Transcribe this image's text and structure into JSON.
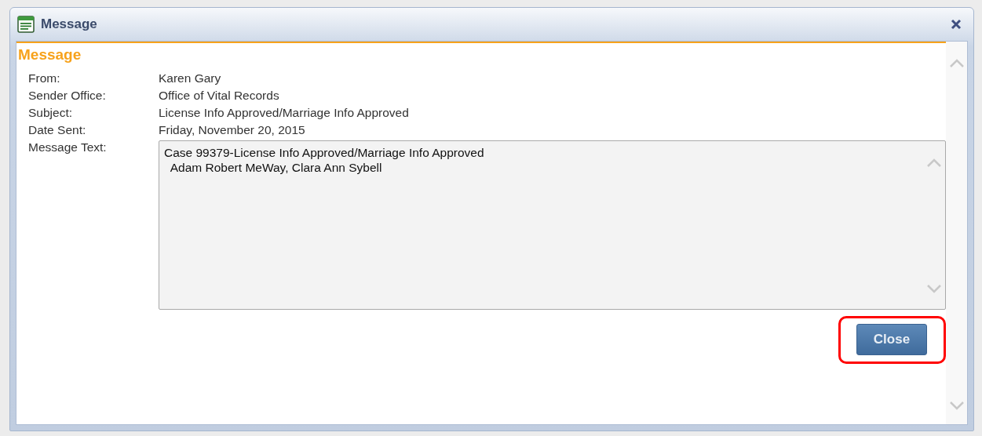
{
  "window": {
    "title": "Message"
  },
  "section_title": "Message",
  "fields": [
    {
      "label": "From:",
      "value": "Karen Gary"
    },
    {
      "label": "Sender Office:",
      "value": "Office of Vital Records"
    },
    {
      "label": "Subject:",
      "value": "License Info Approved/Marriage Info Approved"
    },
    {
      "label": "Date Sent:",
      "value": "Friday, November 20, 2015"
    }
  ],
  "message_text": {
    "label": "Message Text:",
    "lines": [
      "Case 99379-License Info Approved/Marriage Info Approved",
      "  Adam Robert MeWay, Clara Ann Sybell"
    ]
  },
  "close_button": {
    "label": "Close",
    "highlighted": true
  }
}
